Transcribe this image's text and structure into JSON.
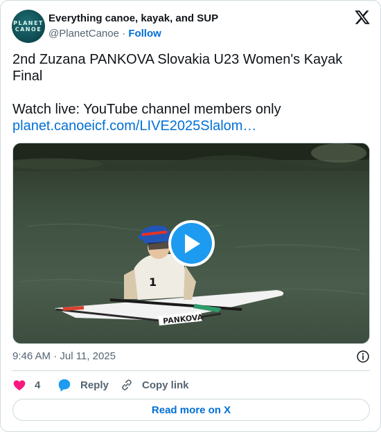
{
  "author": {
    "display_name": "Everything canoe, kayak, and SUP",
    "handle": "@PlanetCanoe",
    "separator": "·",
    "follow_label": "Follow",
    "avatar_text_line1": "PLANET",
    "avatar_text_line2": "CANOE"
  },
  "tweet": {
    "line1": "2nd Zuzana PANKOVA Slovakia U23 Women's Kayak Final",
    "line2": "Watch live: YouTube channel members only",
    "link_text": "planet.canoeicf.com/LIVE2025Slalom…"
  },
  "media": {
    "type": "video",
    "bib_number": "1",
    "boat_name": "PANKOVA",
    "icon": "play-icon"
  },
  "meta": {
    "timestamp": "9:46 AM · Jul 11, 2025",
    "icon": "info-icon"
  },
  "actions": {
    "like_count": "4",
    "reply_label": "Reply",
    "copy_label": "Copy link"
  },
  "footer": {
    "read_more_label": "Read more on X"
  },
  "colors": {
    "link": "#006fd6",
    "like": "#f91880",
    "reply": "#1d9bf0",
    "play": "#1d9bf0",
    "muted": "#536471",
    "border": "#cfd9de"
  }
}
